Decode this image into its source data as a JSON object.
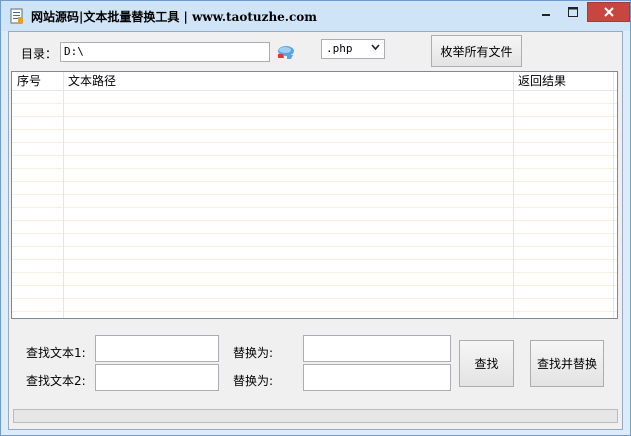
{
  "window": {
    "title": "网站源码|文本批量替换工具  |  www.taotuzhe.com",
    "icon": "document-icon",
    "controls": {
      "minimize_icon": "minimize-icon",
      "maximize_icon": "maximize-icon",
      "close_icon": "close-icon"
    }
  },
  "toolbar": {
    "dir_label": "目录：",
    "dir_value": "D:\\",
    "browse_icon": "folder-browse-icon",
    "extension": {
      "selected": ".php",
      "arrow_icon": "chevron-down-icon"
    },
    "enumerate_button": "枚举所有文件"
  },
  "list": {
    "columns": [
      "序号",
      "文本路径",
      "返回结果"
    ],
    "rows": []
  },
  "search": {
    "find1_label": "查找文本1:",
    "find1_value": "",
    "replace1_label": "替换为:",
    "replace1_value": "",
    "find2_label": "查找文本2:",
    "find2_value": "",
    "replace2_label": "替换为:",
    "replace2_value": "",
    "find_button": "查找",
    "find_replace_button": "查找并替换"
  },
  "progress": {
    "value": 0
  },
  "colors": {
    "close_button": "#c7463f",
    "titlebar": "#cfe4f6",
    "row_line": "#f3f1dc"
  }
}
